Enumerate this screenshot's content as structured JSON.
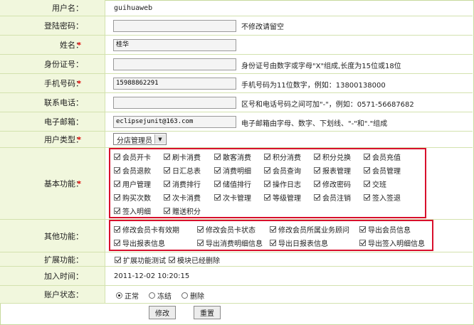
{
  "form": {
    "username": {
      "label": "用户名：",
      "value": "guihuaweb"
    },
    "password": {
      "label": "登陆密码：",
      "value": "",
      "hint": "不修改请留空"
    },
    "name": {
      "label": "姓名：",
      "required": "*",
      "value": "桂华"
    },
    "idcard": {
      "label": "身份证号：",
      "value": "",
      "hint": "身份证号由数字或字母\"X\"组成,长度为15位或18位"
    },
    "mobile": {
      "label": "手机号码：",
      "required": "*",
      "value": "15988862291",
      "hint": "手机号码为11位数字，例如：13800138000"
    },
    "phone": {
      "label": "联系电话：",
      "value": "",
      "hint": "区号和电话号码之间可加\"-\"，例如：0571-56687682"
    },
    "email": {
      "label": "电子邮箱：",
      "value": "eclipsejunit@163.com",
      "hint": "电子邮箱由字母、数字、下划线、\"-\"和\".\"组成"
    },
    "usertype": {
      "label": "用户类型：",
      "required": "*",
      "value": "分店管理员"
    },
    "basic": {
      "label": "基本功能：",
      "required": "*",
      "items": [
        "会员开卡",
        "刷卡消费",
        "散客消费",
        "积分消费",
        "积分兑换",
        "会员充值",
        "会员退款",
        "日汇总表",
        "消费明细",
        "会员查询",
        "报表管理",
        "会员管理",
        "用户管理",
        "消费排行",
        "储值排行",
        "操作日志",
        "修改密码",
        "交班",
        "购买次数",
        "次卡消费",
        "次卡管理",
        "等级管理",
        "会员注销",
        "签入签退",
        "签入明细",
        "赠送积分"
      ]
    },
    "other": {
      "label": "其他功能：",
      "items": [
        "修改会员卡有效期",
        "修改会员卡状态",
        "修改会员所属业务顾问",
        "导出会员信息",
        "导出报表信息",
        "导出消费明细信息",
        "导出日报表信息",
        "导出签入明细信息"
      ]
    },
    "extend": {
      "label": "扩展功能：",
      "items": [
        "扩展功能测试",
        "模块已经删除"
      ]
    },
    "jointime": {
      "label": "加入时间：",
      "value": "2011-12-02 10:20:15"
    },
    "status": {
      "label": "账户状态：",
      "options": [
        "正常",
        "冻结",
        "删除"
      ],
      "selected": "正常"
    }
  },
  "buttons": {
    "submit": "修改",
    "reset": "重置"
  }
}
